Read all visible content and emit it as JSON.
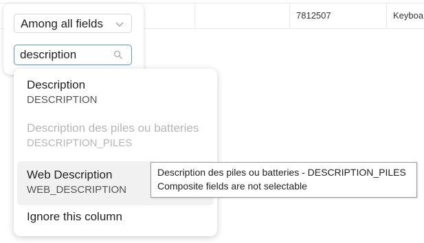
{
  "table": {
    "row": {
      "cell1": "",
      "cell2": "",
      "cell3": "7812507",
      "cell4": "Keyboa"
    }
  },
  "filter": {
    "scope_label": "Among all fields",
    "search_value": "description",
    "icons": {
      "scope": "chevron-down-icon",
      "search": "search-icon"
    }
  },
  "dropdown": {
    "options": [
      {
        "title": "Description",
        "code": "DESCRIPTION",
        "disabled": false
      },
      {
        "title": "Description des piles ou batteries",
        "code": "DESCRIPTION_PILES",
        "disabled": true
      },
      {
        "title": "Web Description",
        "code": "WEB_DESCRIPTION",
        "disabled": false,
        "hovered": true
      }
    ],
    "ignore_label": "Ignore this column"
  },
  "tooltip": {
    "line1": "Description des piles ou batteries - DESCRIPTION_PILES",
    "line2": "Composite fields are not selectable"
  },
  "colors": {
    "focus_border": "#4f97e6",
    "hover_bg": "#f1f1f1",
    "disabled_text": "#b6b6b6"
  }
}
